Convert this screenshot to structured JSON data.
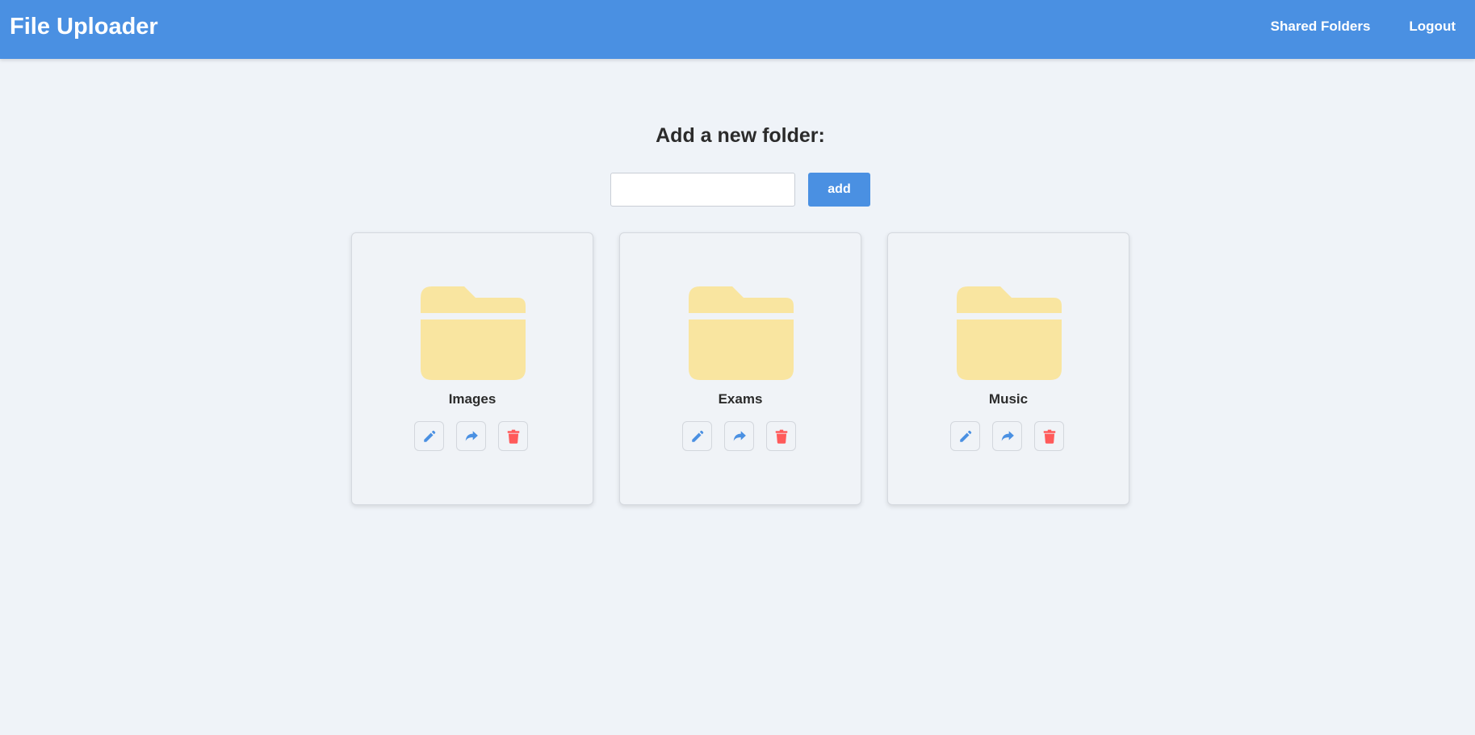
{
  "app": {
    "title": "File Uploader"
  },
  "nav": {
    "links": [
      {
        "label": "Shared Folders"
      },
      {
        "label": "Logout"
      }
    ]
  },
  "main": {
    "heading": "Add a new folder:",
    "input_value": "",
    "add_label": "add"
  },
  "folders": [
    {
      "name": "Images",
      "icon": "folder-icon",
      "actions": [
        "edit-icon",
        "share-icon",
        "trash-icon"
      ]
    },
    {
      "name": "Exams",
      "icon": "folder-icon",
      "actions": [
        "edit-icon",
        "share-icon",
        "trash-icon"
      ]
    },
    {
      "name": "Music",
      "icon": "folder-icon",
      "actions": [
        "edit-icon",
        "share-icon",
        "trash-icon"
      ]
    }
  ],
  "colors": {
    "primary": "#4a90e2",
    "background": "#eff3f8",
    "folder": "#f9e5a0",
    "delete": "#ff5a5a"
  }
}
